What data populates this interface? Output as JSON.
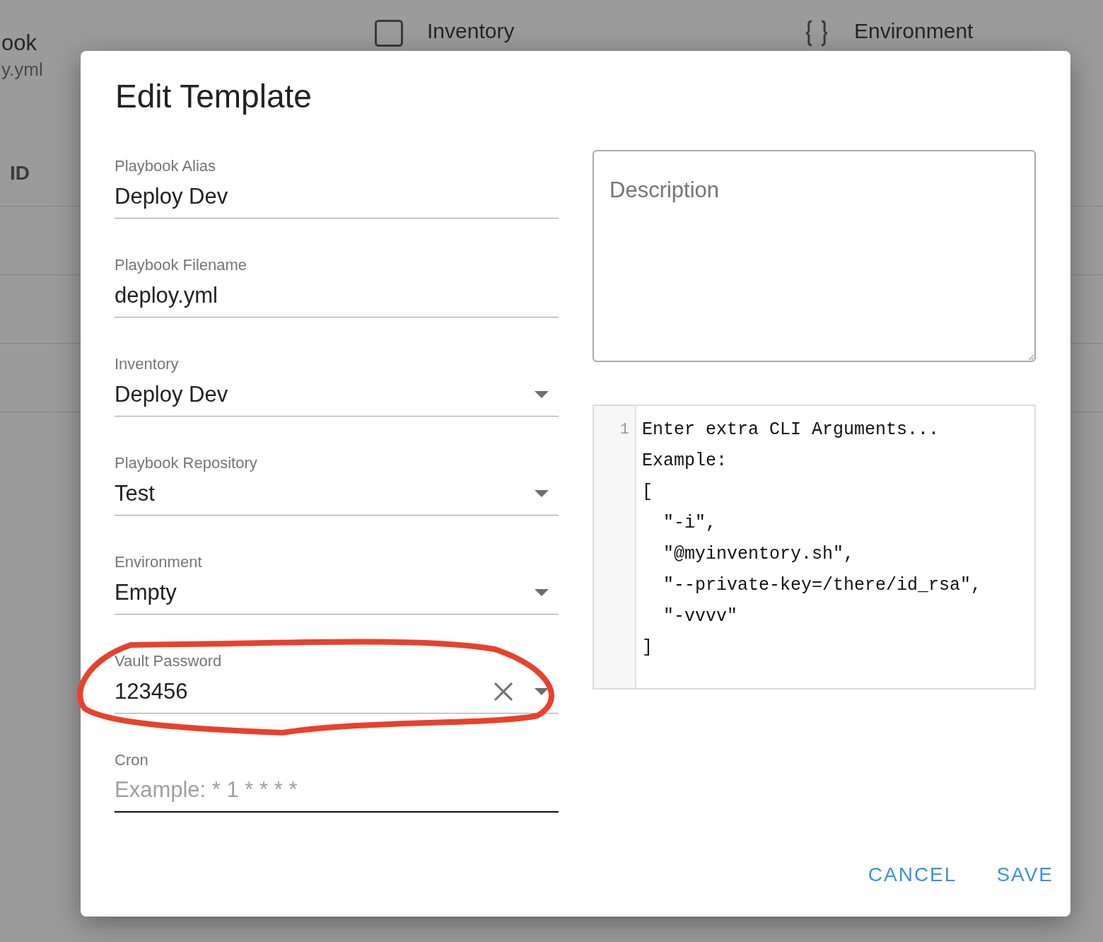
{
  "background": {
    "header": {
      "playbook_name": "ook",
      "playbook_file": "y.yml",
      "inventory_label": "Inventory",
      "environment_label": "Environment"
    },
    "table_header": "ID"
  },
  "dialog": {
    "title": "Edit Template",
    "fields": [
      {
        "kind": "text",
        "label": "Playbook Alias",
        "value": "Deploy Dev",
        "focused": false
      },
      {
        "kind": "text",
        "label": "Playbook Filename",
        "value": "deploy.yml",
        "focused": false
      },
      {
        "kind": "select",
        "label": "Inventory",
        "value": "Deploy Dev",
        "focused": false
      },
      {
        "kind": "select",
        "label": "Playbook Repository",
        "value": "Test",
        "focused": false
      },
      {
        "kind": "select",
        "label": "Environment",
        "value": "Empty",
        "focused": false
      },
      {
        "kind": "clearable_select",
        "label": "Vault Password",
        "value": "123456",
        "focused": false
      },
      {
        "kind": "text",
        "label": "Cron",
        "placeholder": "Example: * 1 * * * *",
        "focused": true
      }
    ],
    "description": {
      "placeholder": "Description"
    },
    "cli_arguments": {
      "line_number": "1",
      "placeholder_lines": [
        "Enter extra CLI Arguments...",
        "Example:",
        "[",
        "  \"-i\",",
        "  \"@myinventory.sh\",",
        "  \"--private-key=/there/id_rsa\",",
        "  \"-vvvv\"",
        "]"
      ]
    },
    "buttons": [
      "CANCEL",
      "SAVE"
    ]
  }
}
